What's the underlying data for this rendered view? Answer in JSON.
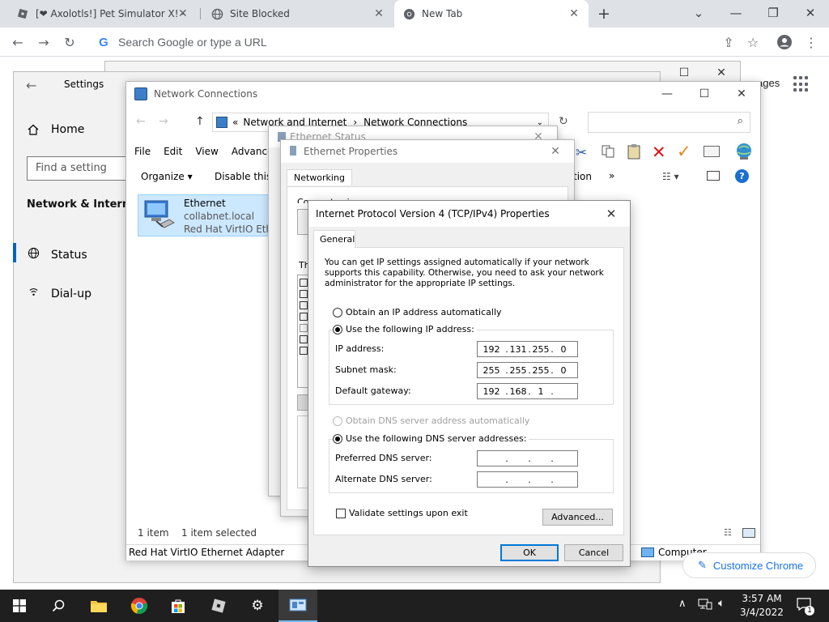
{
  "browser": {
    "tabs": [
      {
        "title": "[❤ Axolotls!] Pet Simulator X! - R",
        "active": false
      },
      {
        "title": "Site Blocked",
        "active": false
      },
      {
        "title": "New Tab",
        "active": true
      }
    ],
    "new_tab_symbol": "+",
    "omnibox_placeholder": "Search Google or type a URL",
    "ntp_images_partial": "ages",
    "customize_label": "Customize Chrome"
  },
  "settings": {
    "title": "Settings",
    "home": "Home",
    "search_placeholder": "Find a setting",
    "section": "Network & Internet",
    "items": [
      {
        "label": "Status",
        "icon": "globe-icon"
      },
      {
        "label": "Dial-up",
        "icon": "dialup-icon"
      }
    ]
  },
  "network_connections": {
    "title": "Network Connections",
    "breadcrumb": [
      "Network and Internet",
      "Network Connections"
    ],
    "menu": [
      "File",
      "Edit",
      "View",
      "Advanced"
    ],
    "commands": [
      "Organize ▾",
      "Disable this n",
      "tion",
      "»"
    ],
    "adapter": {
      "name": "Ethernet",
      "domain": "collabnet.local",
      "device": "Red Hat VirtIO Ether"
    },
    "status_left": "1 item",
    "status_right": "1 item selected",
    "bottom_left": "Red Hat VirtIO Ethernet Adapter",
    "bottom_right": "Computer"
  },
  "ethernet_status": {
    "title": "Ethernet Status"
  },
  "ethernet_properties": {
    "title": "Ethernet Properties",
    "tab": "Networking",
    "connect_using_partial": "Connect using:",
    "this_partial": "Th"
  },
  "ipv4": {
    "title": "Internet Protocol Version 4 (TCP/IPv4) Properties",
    "tab": "General",
    "description": "You can get IP settings assigned automatically if your network supports this capability. Otherwise, you need to ask your network administrator for the appropriate IP settings.",
    "obtain_ip_auto": "Obtain an IP address automatically",
    "use_following_ip": "Use the following IP address:",
    "ip_label": "IP address:",
    "subnet_label": "Subnet mask:",
    "gateway_label": "Default gateway:",
    "ip": [
      "192",
      "131",
      "255",
      "0"
    ],
    "subnet": [
      "255",
      "255",
      "255",
      "0"
    ],
    "gateway": [
      "192",
      "168",
      "1",
      ""
    ],
    "obtain_dns_auto": "Obtain DNS server address automatically",
    "use_following_dns": "Use the following DNS server addresses:",
    "preferred_dns_label": "Preferred DNS server:",
    "alternate_dns_label": "Alternate DNS server:",
    "validate_label": "Validate settings upon exit",
    "advanced_button": "Advanced...",
    "ok_button": "OK",
    "cancel_button": "Cancel"
  },
  "taskbar": {
    "time": "3:57 AM",
    "date": "3/4/2022",
    "notification_count": "1"
  }
}
